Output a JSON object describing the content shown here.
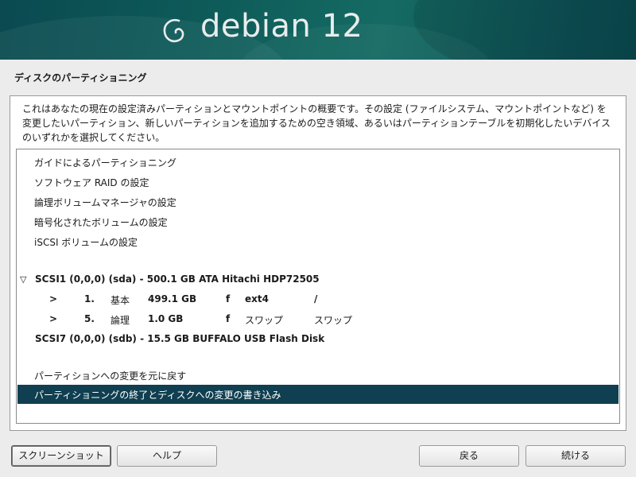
{
  "header": {
    "product_title": "debian 12"
  },
  "page": {
    "title": "ディスクのパーティショニング",
    "description": [
      "これはあなたの現在の設定済みパーティションとマウントポイントの概要です。その設定 (ファイルシステム、マウントポイントなど) を",
      "変更したいパーティション、新しいパーティションを追加するための空き領域、あるいはパーティションテーブルを初期化したいデバイス",
      "のいずれかを選択してください。"
    ]
  },
  "list": {
    "menu_items": [
      "ガイドによるパーティショニング",
      "ソフトウェア RAID の設定",
      "論理ボリュームマネージャの設定",
      "暗号化されたボリュームの設定",
      "iSCSI ボリュームの設定"
    ],
    "disk1": {
      "expander": "▽",
      "label": "SCSI1 (0,0,0) (sda) - 500.1 GB ATA Hitachi HDP72505",
      "partitions": [
        {
          "arrow": ">",
          "number": "1.",
          "type": "基本",
          "size": "499.1 GB",
          "flag": "f",
          "fs": "ext4",
          "mount": "/"
        },
        {
          "arrow": ">",
          "number": "5.",
          "type": "論理",
          "size": "1.0 GB",
          "flag": "f",
          "fs": "スワップ",
          "mount": "スワップ"
        }
      ]
    },
    "disk2": {
      "label": "SCSI7 (0,0,0) (sdb) - 15.5 GB BUFFALO USB Flash Disk"
    },
    "undo_changes": "パーティションへの変更を元に戻す",
    "finish_write": "パーティショニングの終了とディスクへの変更の書き込み"
  },
  "buttons": {
    "screenshot": "スクリーンショット",
    "help": "ヘルプ",
    "back": "戻る",
    "continue": "続ける"
  },
  "colors": {
    "selection": "#0f3f50",
    "banner": "#0e5c5a"
  }
}
